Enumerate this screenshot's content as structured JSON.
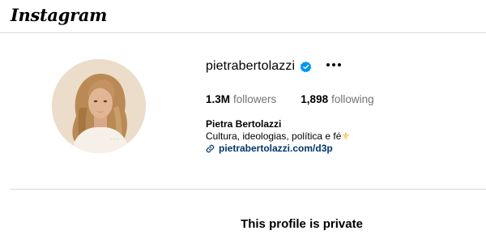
{
  "app": {
    "logo_text": "Instagram"
  },
  "profile": {
    "username": "pietrabertolazzi",
    "verified": true,
    "more_label": "•••",
    "stats": {
      "followers_count": "1.3M",
      "followers_label": "followers",
      "following_count": "1,898",
      "following_label": "following"
    },
    "full_name": "Pietra Bertolazzi",
    "bio_text": "Cultura, ideologias, política e fé",
    "bio_emoji": "⚜",
    "link": "pietrabertolazzi.com/d3p"
  },
  "private_message": "This profile is private",
  "colors": {
    "link": "#00376b",
    "muted": "#737373",
    "verified_badge": "#0095f6",
    "divider": "#dbdbdb"
  }
}
